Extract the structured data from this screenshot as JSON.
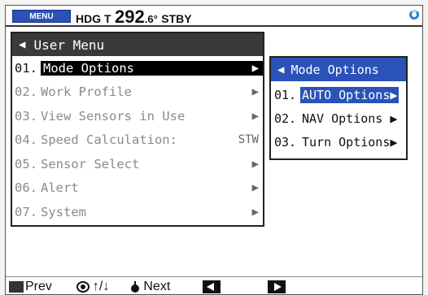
{
  "status_bar": {
    "menu_label": "MENU",
    "hdg_label": "HDG T",
    "hdg_value": "292",
    "hdg_decimal": ".6°",
    "mode": "STBY",
    "icon": "busy-spinner-icon"
  },
  "user_menu": {
    "title": "User Menu",
    "items": [
      {
        "num": "01.",
        "label": "Mode Options",
        "right": "▶"
      },
      {
        "num": "02.",
        "label": "Work Profile",
        "right": "▶"
      },
      {
        "num": "03.",
        "label": "View Sensors in Use",
        "right": "▶"
      },
      {
        "num": "04.",
        "label": "Speed Calculation:",
        "right": "STW"
      },
      {
        "num": "05.",
        "label": "Sensor Select",
        "right": "▶"
      },
      {
        "num": "06.",
        "label": "Alert",
        "right": "▶"
      },
      {
        "num": "07.",
        "label": "System",
        "right": "▶"
      }
    ]
  },
  "mode_menu": {
    "title": "Mode Options",
    "items": [
      {
        "num": "01.",
        "label": "AUTO Options▶"
      },
      {
        "num": "02.",
        "label": "NAV Options ▶"
      },
      {
        "num": "03.",
        "label": "Turn Options▶"
      }
    ]
  },
  "bottom_bar": {
    "prev": "Prev",
    "updown": "↑/↓",
    "next": "Next"
  },
  "colors": {
    "accent_blue": "#2a52b8",
    "selection_black": "#000000",
    "title_dark": "#3a3a3a"
  }
}
